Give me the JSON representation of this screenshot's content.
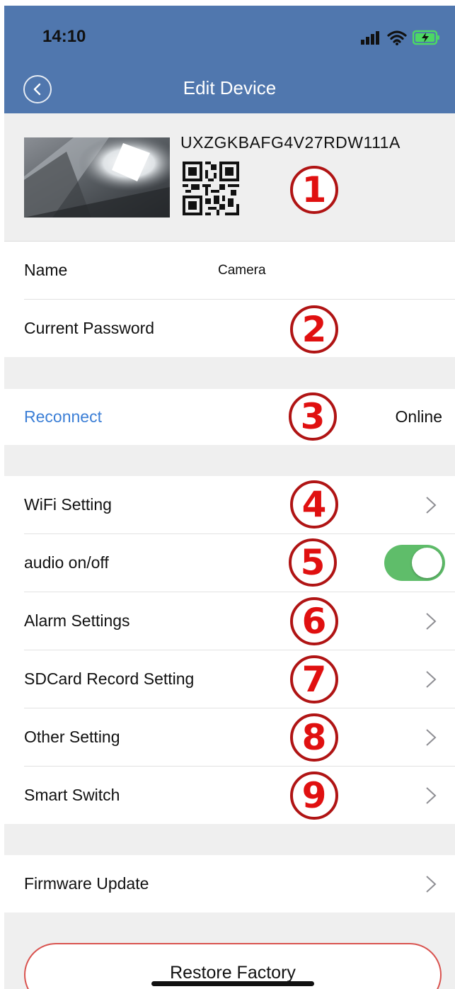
{
  "status_bar": {
    "time": "14:10",
    "icons": [
      "signal-icon",
      "wifi-icon",
      "battery-charging-icon"
    ]
  },
  "header": {
    "title": "Edit Device",
    "back_icon": "back-icon"
  },
  "device": {
    "uid": "UXZGKBAFG4V27RDW111A"
  },
  "rows": {
    "name": {
      "label": "Name",
      "value": "Camera"
    },
    "password": {
      "label": "Current Password"
    },
    "reconnect": {
      "label": "Reconnect",
      "status": "Online"
    },
    "wifi": {
      "label": "WiFi Setting"
    },
    "audio": {
      "label": "audio on/off",
      "enabled": true
    },
    "alarm": {
      "label": "Alarm Settings"
    },
    "sdcard": {
      "label": "SDCard Record Setting"
    },
    "other": {
      "label": "Other Setting"
    },
    "smart": {
      "label": "Smart Switch"
    },
    "firmware": {
      "label": "Firmware Update"
    }
  },
  "restore": {
    "label": "Restore Factory"
  },
  "annotations": [
    "1",
    "2",
    "3",
    "4",
    "5",
    "6",
    "7",
    "8",
    "9"
  ],
  "colors": {
    "header": "#5077ae",
    "link": "#3c7fd6",
    "toggle_on": "#5fbd6a",
    "annotation": "#e01010",
    "restore_border": "#d9534f"
  }
}
